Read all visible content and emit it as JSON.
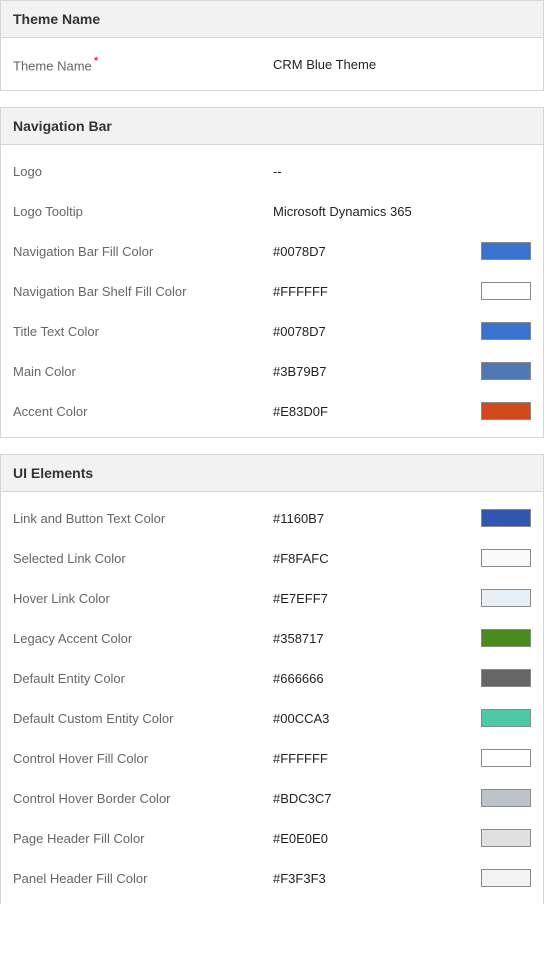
{
  "sections": {
    "theme": {
      "title": "Theme Name",
      "fields": {
        "name": {
          "label": "Theme Name",
          "required": "*",
          "value": "CRM Blue Theme"
        }
      }
    },
    "nav": {
      "title": "Navigation Bar",
      "fields": {
        "logo": {
          "label": "Logo",
          "value": "--"
        },
        "logo_tooltip": {
          "label": "Logo Tooltip",
          "value": "Microsoft Dynamics 365"
        },
        "nav_fill": {
          "label": "Navigation Bar Fill Color",
          "value": "#0078D7",
          "swatch": "#3A72CF"
        },
        "nav_shelf": {
          "label": "Navigation Bar Shelf Fill Color",
          "value": "#FFFFFF",
          "swatch": "#FFFFFF"
        },
        "title_text": {
          "label": "Title Text Color",
          "value": "#0078D7",
          "swatch": "#3A72CF"
        },
        "main_color": {
          "label": "Main Color",
          "value": "#3B79B7",
          "swatch": "#4F78B5"
        },
        "accent_color": {
          "label": "Accent Color",
          "value": "#E83D0F",
          "swatch": "#D14A1E"
        }
      }
    },
    "ui": {
      "title": "UI Elements",
      "fields": {
        "link_button": {
          "label": "Link and Button Text Color",
          "value": "#1160B7",
          "swatch": "#3056AE"
        },
        "selected_link": {
          "label": "Selected Link Color",
          "value": "#F8FAFC",
          "swatch": "#F8FAFC"
        },
        "hover_link": {
          "label": "Hover Link Color",
          "value": "#E7EFF7",
          "swatch": "#E7EFF7"
        },
        "legacy_accent": {
          "label": "Legacy Accent Color",
          "value": "#358717",
          "swatch": "#4B8A1F"
        },
        "default_entity": {
          "label": "Default Entity Color",
          "value": "#666666",
          "swatch": "#666666"
        },
        "custom_entity": {
          "label": "Default Custom Entity Color",
          "value": "#00CCA3",
          "swatch": "#4DC9A6"
        },
        "control_hover_fill": {
          "label": "Control Hover Fill Color",
          "value": "#FFFFFF",
          "swatch": "#FFFFFF"
        },
        "control_hover_border": {
          "label": "Control Hover Border Color",
          "value": "#BDC3C7",
          "swatch": "#BDC3C7"
        },
        "page_header": {
          "label": "Page Header Fill Color",
          "value": "#E0E0E0",
          "swatch": "#E0E0E0"
        },
        "panel_header": {
          "label": "Panel Header Fill Color",
          "value": "#F3F3F3",
          "swatch": "#F3F3F3"
        }
      }
    }
  }
}
